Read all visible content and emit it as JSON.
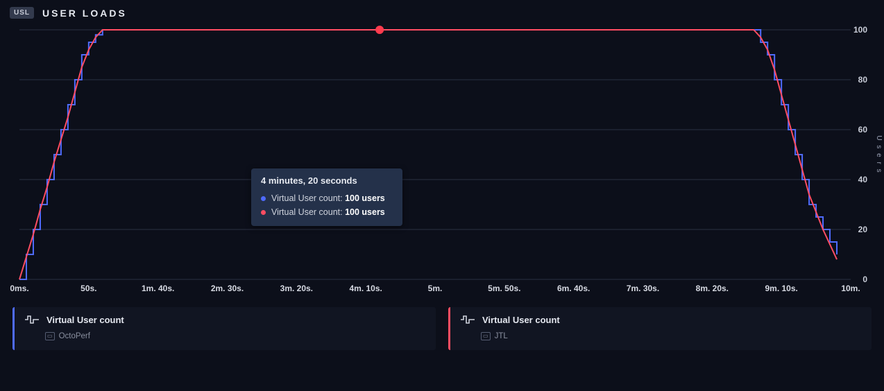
{
  "header": {
    "badge": "USL",
    "title": "USER LOADS"
  },
  "tooltip": {
    "title": "4 minutes, 20 seconds",
    "rows": [
      {
        "color": "#4f6bff",
        "label": "Virtual User count:",
        "value": "100 users"
      },
      {
        "color": "#ff4d62",
        "label": "Virtual User count:",
        "value": "100 users"
      }
    ]
  },
  "legend": [
    {
      "color": "#4f6bff",
      "title": "Virtual User count",
      "source": "OctoPerf"
    },
    {
      "color": "#ff4d62",
      "title": "Virtual User count",
      "source": "JTL"
    }
  ],
  "chart_data": {
    "type": "line",
    "title": "USER LOADS",
    "xlabel": "",
    "ylabel": "Users",
    "ylim": [
      0,
      100
    ],
    "x_ticks": [
      "0ms.",
      "50s.",
      "1m. 40s.",
      "2m. 30s.",
      "3m. 20s.",
      "4m. 10s.",
      "5m.",
      "5m. 50s.",
      "6m. 40s.",
      "7m. 30s.",
      "8m. 20s.",
      "9m. 10s.",
      "10m."
    ],
    "y_ticks": [
      0,
      20,
      40,
      60,
      80,
      100
    ],
    "x_seconds": [
      0,
      50,
      100,
      150,
      200,
      250,
      300,
      350,
      400,
      450,
      500,
      550,
      600
    ],
    "marker_seconds": 260,
    "series": [
      {
        "name": "OctoPerf",
        "color": "#4f6bff",
        "step": true,
        "x": [
          0,
          5,
          10,
          15,
          20,
          25,
          30,
          35,
          40,
          45,
          50,
          55,
          60,
          530,
          535,
          540,
          545,
          550,
          555,
          560,
          565,
          570,
          575,
          580,
          585,
          590
        ],
        "y": [
          0,
          10,
          20,
          30,
          40,
          50,
          60,
          70,
          80,
          90,
          95,
          98,
          100,
          100,
          95,
          90,
          80,
          70,
          60,
          50,
          40,
          30,
          25,
          20,
          15,
          10
        ]
      },
      {
        "name": "JTL",
        "color": "#ff4d62",
        "step": false,
        "x": [
          0,
          5,
          10,
          15,
          20,
          25,
          30,
          35,
          40,
          45,
          50,
          55,
          60,
          530,
          535,
          540,
          545,
          550,
          555,
          560,
          565,
          570,
          575,
          580,
          585,
          590
        ],
        "y": [
          0,
          9,
          18,
          28,
          37,
          47,
          56,
          65,
          75,
          85,
          92,
          97,
          100,
          100,
          97,
          92,
          84,
          74,
          64,
          54,
          44,
          34,
          27,
          20,
          14,
          8
        ]
      }
    ]
  }
}
